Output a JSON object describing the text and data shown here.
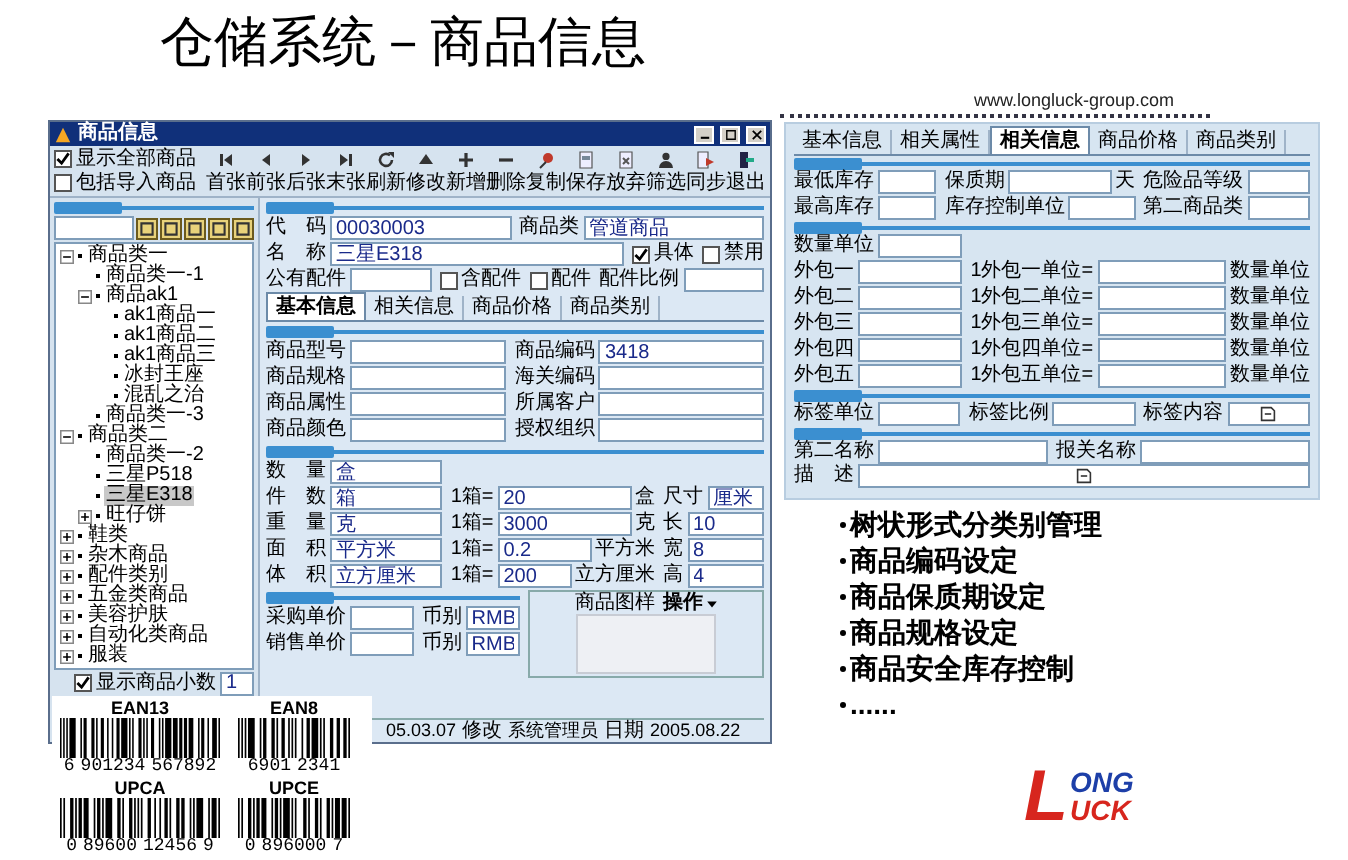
{
  "slide_title": "仓储系统－商品信息",
  "website": "www.longluck-group.com",
  "main_window": {
    "title": "商品信息",
    "options": [
      {
        "label": "显示全部商品",
        "checked": true
      },
      {
        "label": "包括导入商品",
        "checked": false
      }
    ],
    "toolbar": [
      {
        "kind": "first",
        "label": "首张"
      },
      {
        "kind": "prev",
        "label": "前张"
      },
      {
        "kind": "next",
        "label": "后张"
      },
      {
        "kind": "last",
        "label": "末张"
      },
      {
        "kind": "refresh",
        "label": "刷新"
      },
      {
        "kind": "edit",
        "label": "修改"
      },
      {
        "kind": "add",
        "label": "新增"
      },
      {
        "kind": "delete",
        "label": "删除"
      },
      {
        "kind": "copy",
        "label": "复制"
      },
      {
        "kind": "save",
        "label": "保存"
      },
      {
        "kind": "cancel",
        "label": "放弃"
      },
      {
        "kind": "filter",
        "label": "筛选"
      },
      {
        "kind": "sync",
        "label": "同步"
      },
      {
        "kind": "exit",
        "label": "退出"
      }
    ],
    "category_tree": [
      {
        "label": "商品类一",
        "expanded": true,
        "selected": false,
        "children": [
          {
            "label": "商品类一-1",
            "selected": false
          },
          {
            "label": "商品ak1",
            "expanded": true,
            "selected": false,
            "children": [
              {
                "label": "ak1商品一",
                "selected": false
              },
              {
                "label": "ak1商品二",
                "selected": false
              },
              {
                "label": "ak1商品三",
                "selected": false
              },
              {
                "label": "冰封王座",
                "selected": false
              },
              {
                "label": "混乱之治",
                "selected": false
              }
            ]
          },
          {
            "label": "商品类一-3",
            "selected": false
          }
        ]
      },
      {
        "label": "商品类二",
        "expanded": true,
        "selected": false,
        "children": [
          {
            "label": "商品类一-2",
            "selected": false
          },
          {
            "label": "三星P518",
            "selected": false
          },
          {
            "label": "三星E318",
            "selected": true
          },
          {
            "label": "旺仔饼",
            "expanded": false,
            "selected": false
          }
        ]
      },
      {
        "label": "鞋类",
        "expanded": false,
        "selected": false
      },
      {
        "label": "杂木商品",
        "expanded": false,
        "selected": false
      },
      {
        "label": "配件类别",
        "expanded": false,
        "selected": false
      },
      {
        "label": "五金类商品",
        "expanded": false,
        "selected": false
      },
      {
        "label": "美容护肤",
        "expanded": false,
        "selected": false
      },
      {
        "label": "自动化类商品",
        "expanded": false,
        "selected": false
      },
      {
        "label": "服装",
        "expanded": false,
        "selected": false
      }
    ],
    "decimal_option": {
      "label": "显示商品小数",
      "checked": true,
      "value": "1"
    },
    "header_rows": [
      [
        {
          "kind": "field",
          "label": "代　码",
          "value": "00030003"
        },
        {
          "kind": "field",
          "label": "商品类",
          "value": "管道商品"
        }
      ],
      [
        {
          "kind": "field",
          "label": "名　称",
          "value": "三星E318"
        },
        {
          "kind": "check",
          "label": "具体",
          "checked": true
        },
        {
          "kind": "check",
          "label": "禁用",
          "checked": false
        }
      ],
      [
        {
          "kind": "field",
          "label": "公有配件"
        },
        {
          "kind": "check",
          "label": "含配件",
          "checked": false
        },
        {
          "kind": "check",
          "label": "配件",
          "checked": false
        },
        {
          "kind": "field",
          "label": "配件比例"
        }
      ]
    ],
    "tabs": [
      {
        "label": "基本信息",
        "selected": true
      },
      {
        "label": "相关信息",
        "selected": false
      },
      {
        "label": "商品价格",
        "selected": false
      },
      {
        "label": "商品类别",
        "selected": false
      }
    ],
    "sections": [
      {
        "rows": [
          [
            {
              "kind": "field",
              "label": "商品型号"
            },
            {
              "kind": "field",
              "label": "商品编码",
              "value": "3418"
            }
          ],
          [
            {
              "kind": "field",
              "label": "商品规格"
            },
            {
              "kind": "field",
              "label": "海关编码"
            }
          ],
          [
            {
              "kind": "field",
              "label": "商品属性"
            },
            {
              "kind": "field",
              "label": "所属客户"
            }
          ],
          [
            {
              "kind": "field",
              "label": "商品颜色"
            },
            {
              "kind": "field",
              "label": "授权组织"
            }
          ]
        ]
      },
      {
        "rows": [
          [
            {
              "kind": "field",
              "label": "数　量",
              "value": "盒"
            }
          ],
          [
            {
              "kind": "field",
              "label": "件　数",
              "value": "箱"
            },
            {
              "kind": "field",
              "label": "1箱=",
              "value": "20",
              "unit": "盒"
            },
            {
              "kind": "field",
              "label": "尺寸",
              "value": "厘米"
            }
          ],
          [
            {
              "kind": "field",
              "label": "重　量",
              "value": "克"
            },
            {
              "kind": "field",
              "label": "1箱=",
              "value": "3000",
              "unit": "克"
            },
            {
              "kind": "field",
              "label": "长",
              "value": "10"
            }
          ],
          [
            {
              "kind": "field",
              "label": "面　积",
              "value": "平方米"
            },
            {
              "kind": "field",
              "label": "1箱=",
              "value": "0.2",
              "unit": "平方米"
            },
            {
              "kind": "field",
              "label": "宽",
              "value": "8"
            }
          ],
          [
            {
              "kind": "field",
              "label": "体　积",
              "value": "立方厘米"
            },
            {
              "kind": "field",
              "label": "1箱=",
              "value": "200",
              "unit": "立方厘米"
            },
            {
              "kind": "field",
              "label": "高",
              "value": "4"
            }
          ]
        ]
      }
    ],
    "price_rows": [
      [
        {
          "kind": "field",
          "label": "采购单价"
        },
        {
          "kind": "field",
          "label": "币别",
          "value": "RMB"
        }
      ],
      [
        {
          "kind": "field",
          "label": "销售单价"
        },
        {
          "kind": "field",
          "label": "币别",
          "value": "RMB"
        }
      ]
    ],
    "picture": {
      "label": "商品图样",
      "menu": "操作"
    },
    "status_bar": [
      {
        "value": "05.03.07"
      },
      {
        "label": "修改",
        "value": "系统管理员"
      },
      {
        "label": "日期",
        "value": "2005.08.22"
      }
    ]
  },
  "detail_panel": {
    "tabs": [
      {
        "label": "基本信息",
        "selected": false
      },
      {
        "label": "相关属性",
        "selected": false
      },
      {
        "label": "相关信息",
        "selected": true
      },
      {
        "label": "商品价格",
        "selected": false
      },
      {
        "label": "商品类别",
        "selected": false
      }
    ],
    "sections": [
      {
        "rows": [
          [
            {
              "kind": "field",
              "label": "最低库存"
            },
            {
              "kind": "field",
              "label": "保质期",
              "unit": "天"
            },
            {
              "kind": "field",
              "label": "危险品等级"
            }
          ],
          [
            {
              "kind": "field",
              "label": "最高库存"
            },
            {
              "kind": "field",
              "label": "库存控制单位"
            },
            {
              "kind": "field",
              "label": "第二商品类"
            }
          ]
        ]
      },
      {
        "rows": [
          [
            {
              "kind": "field",
              "label": "数量单位"
            }
          ],
          [
            {
              "kind": "field",
              "label": "外包一"
            },
            {
              "kind": "field",
              "label": "1外包一单位=",
              "unit": "数量单位"
            }
          ],
          [
            {
              "kind": "field",
              "label": "外包二"
            },
            {
              "kind": "field",
              "label": "1外包二单位=",
              "unit": "数量单位"
            }
          ],
          [
            {
              "kind": "field",
              "label": "外包三"
            },
            {
              "kind": "field",
              "label": "1外包三单位=",
              "unit": "数量单位"
            }
          ],
          [
            {
              "kind": "field",
              "label": "外包四"
            },
            {
              "kind": "field",
              "label": "1外包四单位=",
              "unit": "数量单位"
            }
          ],
          [
            {
              "kind": "field",
              "label": "外包五"
            },
            {
              "kind": "field",
              "label": "1外包五单位=",
              "unit": "数量单位"
            }
          ]
        ]
      },
      {
        "rows": [
          [
            {
              "kind": "field",
              "label": "标签单位"
            },
            {
              "kind": "field",
              "label": "标签比例"
            },
            {
              "kind": "note",
              "label": "标签内容"
            }
          ]
        ]
      },
      {
        "rows": [
          [
            {
              "kind": "field",
              "label": "第二名称"
            },
            {
              "kind": "field",
              "label": "报关名称"
            }
          ],
          [
            {
              "kind": "note",
              "label": "描　述"
            }
          ]
        ]
      }
    ]
  },
  "barcodes": [
    {
      "label": "EAN13",
      "digits": [
        "6",
        "901234",
        "567892"
      ]
    },
    {
      "label": "EAN8",
      "digits": [
        "6901",
        "2341"
      ]
    },
    {
      "label": "UPCA",
      "digits": [
        "0",
        "89600",
        "12456",
        "9"
      ]
    },
    {
      "label": "UPCE",
      "digits": [
        "0",
        "896000",
        "7"
      ]
    }
  ],
  "features": [
    "树状形式分类别管理",
    "商品编码设定",
    "商品保质期设定",
    "商品规格设定",
    "商品安全库存控制",
    "......"
  ],
  "logo": {
    "mark": "L",
    "lines": [
      "ONG",
      "UCK"
    ]
  }
}
